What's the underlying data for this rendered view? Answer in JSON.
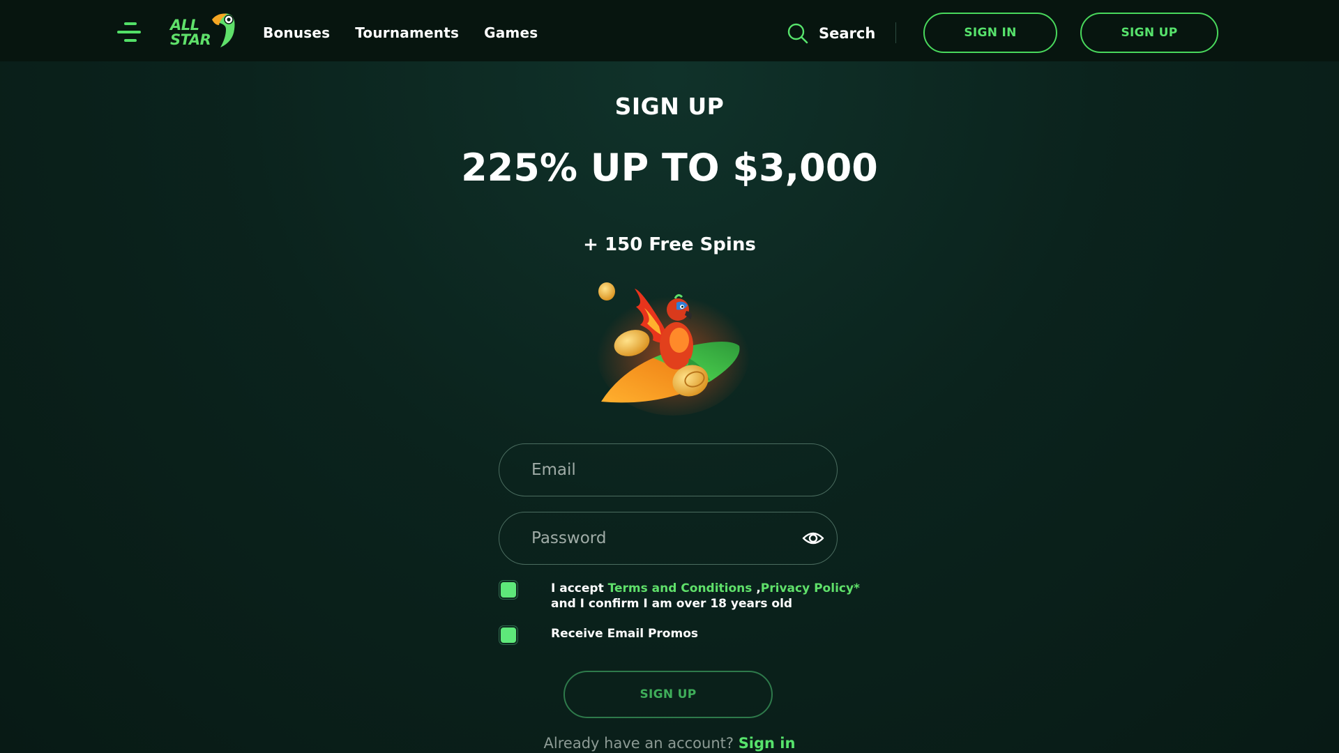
{
  "header": {
    "logo_text": "ALL STAR",
    "nav": [
      "Bonuses",
      "Tournaments",
      "Games"
    ],
    "search_label": "Search",
    "signin_label": "SIGN IN",
    "signup_label": "SIGN UP"
  },
  "main": {
    "title": "SIGN UP",
    "promo_headline": "225% UP TO $3,000",
    "promo_sub": "+ 150 Free Spins",
    "email_placeholder": "Email",
    "password_placeholder": "Password",
    "terms_prefix": "I accept ",
    "terms_link": "Terms and Conditions",
    "terms_comma": " ,",
    "privacy_link": "Privacy Policy*",
    "terms_suffix": "and I confirm I am over 18 years old",
    "promos_label": "Receive Email Promos",
    "submit_label": "SIGN UP",
    "footer_text": "Already have an account? ",
    "footer_link": "Sign in"
  },
  "colors": {
    "accent": "#57e36c",
    "background": "#0b231d",
    "header_bg": "#07150f",
    "field_border": "#4b6d60"
  },
  "icons": {
    "menu": "hamburger-menu-icon",
    "search": "search-icon",
    "password_toggle": "eye-icon",
    "logo_mark": "toucan-icon",
    "hero": "parrot-surfboard-illustration"
  }
}
